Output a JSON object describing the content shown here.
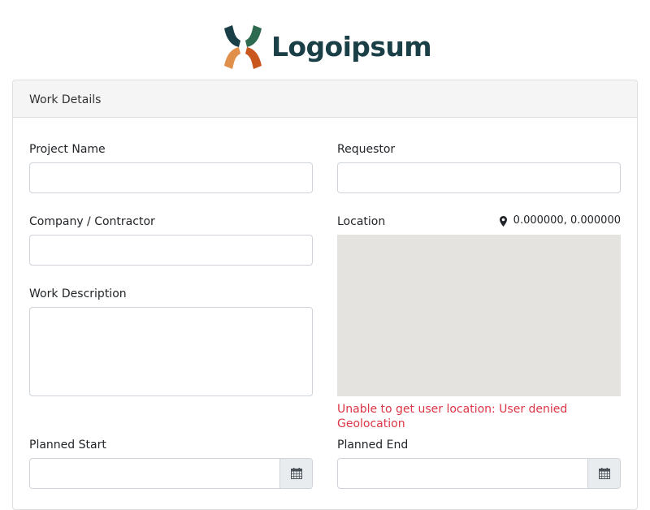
{
  "brand": {
    "name": "Logoipsum",
    "text_color": "#1b3f47",
    "mark_colors": [
      "#1b3f47",
      "#2e6a4f",
      "#e0904a",
      "#c9571e"
    ]
  },
  "card": {
    "title": "Work Details"
  },
  "form": {
    "project_name": {
      "label": "Project Name",
      "value": ""
    },
    "requestor": {
      "label": "Requestor",
      "value": ""
    },
    "company": {
      "label": "Company / Contractor",
      "value": ""
    },
    "location": {
      "label": "Location",
      "coordinates": "0.000000, 0.000000",
      "icon": "map-marker-icon",
      "error": "Unable to get user location: User denied Geolocation",
      "error_color": "#dc3545",
      "map_color": "#e5e3df"
    },
    "work_description": {
      "label": "Work Description",
      "value": ""
    },
    "planned_start": {
      "label": "Planned Start",
      "value": "",
      "icon": "calendar-icon"
    },
    "planned_end": {
      "label": "Planned End",
      "value": "",
      "icon": "calendar-icon"
    }
  }
}
